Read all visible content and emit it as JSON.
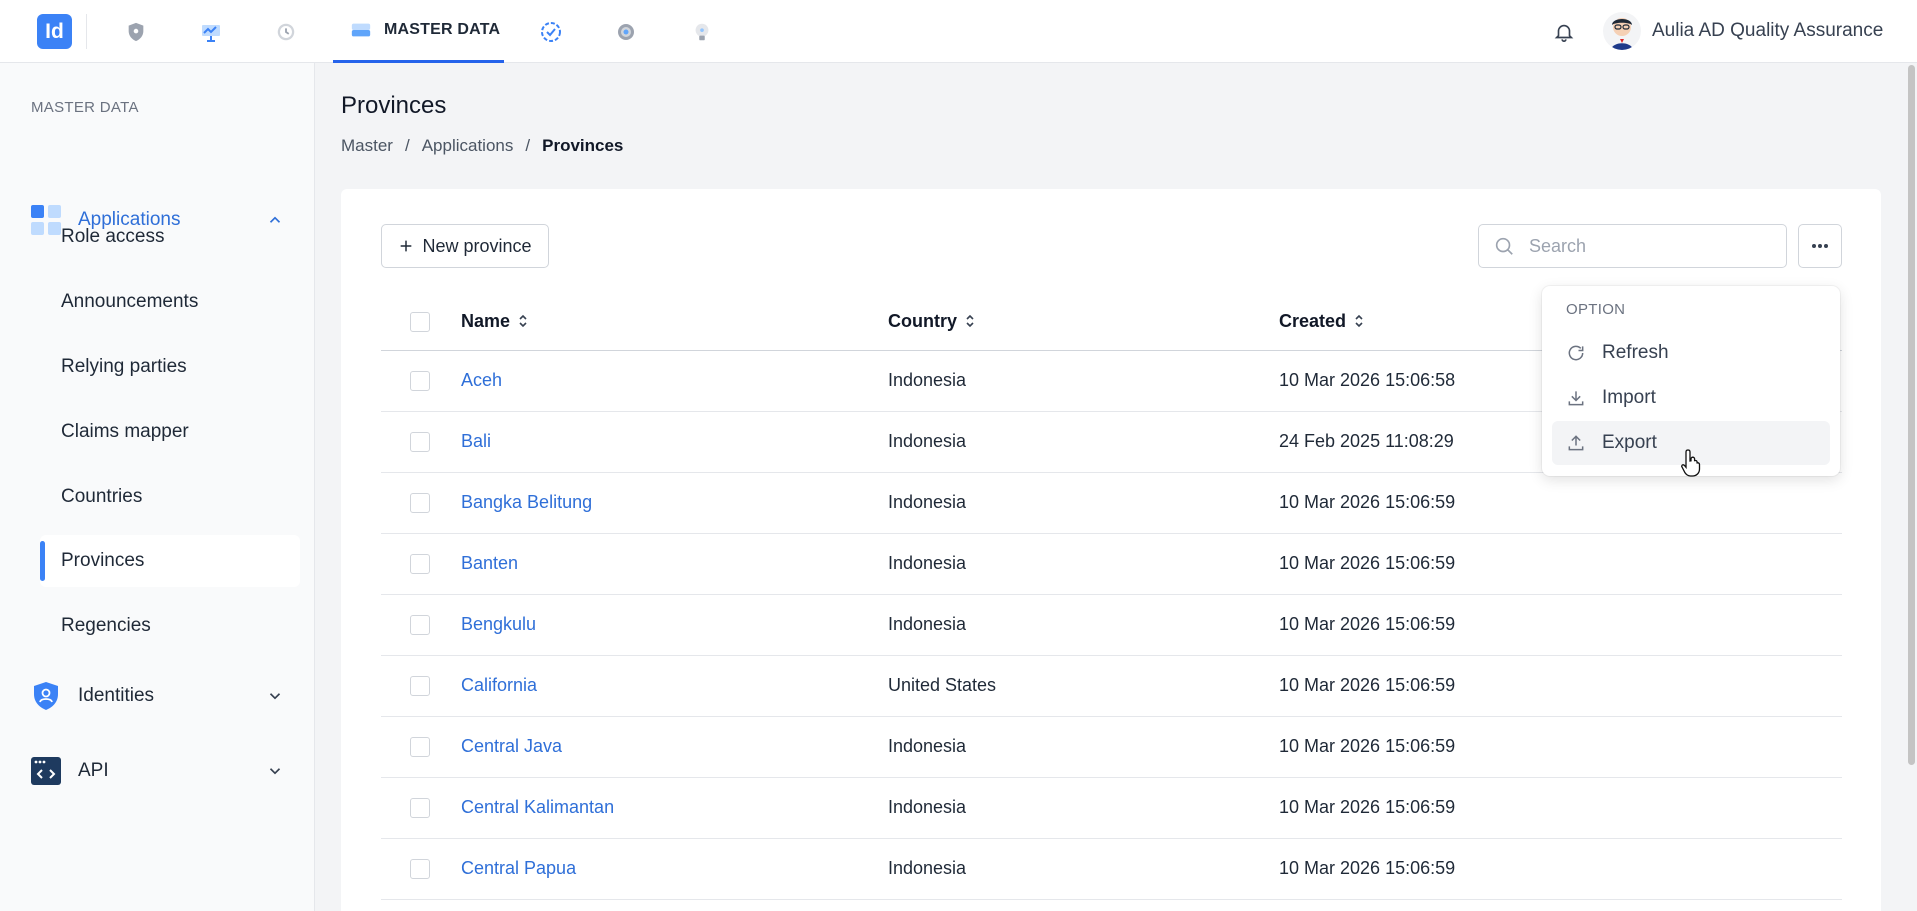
{
  "app": {
    "logo_text": "Id",
    "user_name": "Aulia AD Quality Assurance"
  },
  "topnav": {
    "active_tab": "MASTER DATA",
    "icons": [
      "shield-icon",
      "chart-icon",
      "clock-icon",
      "database-icon",
      "badge-check-icon",
      "gear-icon",
      "lightbulb-icon"
    ]
  },
  "sidebar": {
    "section_title": "MASTER DATA",
    "groups": [
      {
        "label": "Applications",
        "icon": "apps-grid-icon",
        "expanded": true
      },
      {
        "label": "Identities",
        "icon": "shield-user-icon",
        "expanded": false
      },
      {
        "label": "API",
        "icon": "code-window-icon",
        "expanded": false
      }
    ],
    "items": [
      "Role access",
      "Announcements",
      "Relying parties",
      "Claims mapper",
      "Countries",
      "Provinces",
      "Regencies"
    ],
    "active_item": "Provinces"
  },
  "page": {
    "title": "Provinces",
    "breadcrumb": [
      "Master",
      "Applications",
      "Provinces"
    ],
    "new_button": "New province",
    "search_placeholder": "Search"
  },
  "table": {
    "columns": [
      "Name",
      "Country",
      "Created"
    ],
    "rows": [
      {
        "name": "Aceh",
        "country": "Indonesia",
        "created": "10 Mar 2026 15:06:58"
      },
      {
        "name": "Bali",
        "country": "Indonesia",
        "created": "24 Feb 2025 11:08:29"
      },
      {
        "name": "Bangka Belitung",
        "country": "Indonesia",
        "created": "10 Mar 2026 15:06:59"
      },
      {
        "name": "Banten",
        "country": "Indonesia",
        "created": "10 Mar 2026 15:06:59"
      },
      {
        "name": "Bengkulu",
        "country": "Indonesia",
        "created": "10 Mar 2026 15:06:59"
      },
      {
        "name": "California",
        "country": "United States",
        "created": "10 Mar 2026 15:06:59"
      },
      {
        "name": "Central Java",
        "country": "Indonesia",
        "created": "10 Mar 2026 15:06:59"
      },
      {
        "name": "Central Kalimantan",
        "country": "Indonesia",
        "created": "10 Mar 2026 15:06:59"
      },
      {
        "name": "Central Papua",
        "country": "Indonesia",
        "created": "10 Mar 2026 15:06:59"
      }
    ]
  },
  "options_menu": {
    "title": "OPTION",
    "items": [
      {
        "label": "Refresh",
        "icon": "refresh-icon"
      },
      {
        "label": "Import",
        "icon": "download-icon"
      },
      {
        "label": "Export",
        "icon": "upload-icon"
      }
    ],
    "hovered": "Export"
  },
  "colors": {
    "accent": "#3b82f6",
    "link": "#2f6fd8"
  }
}
